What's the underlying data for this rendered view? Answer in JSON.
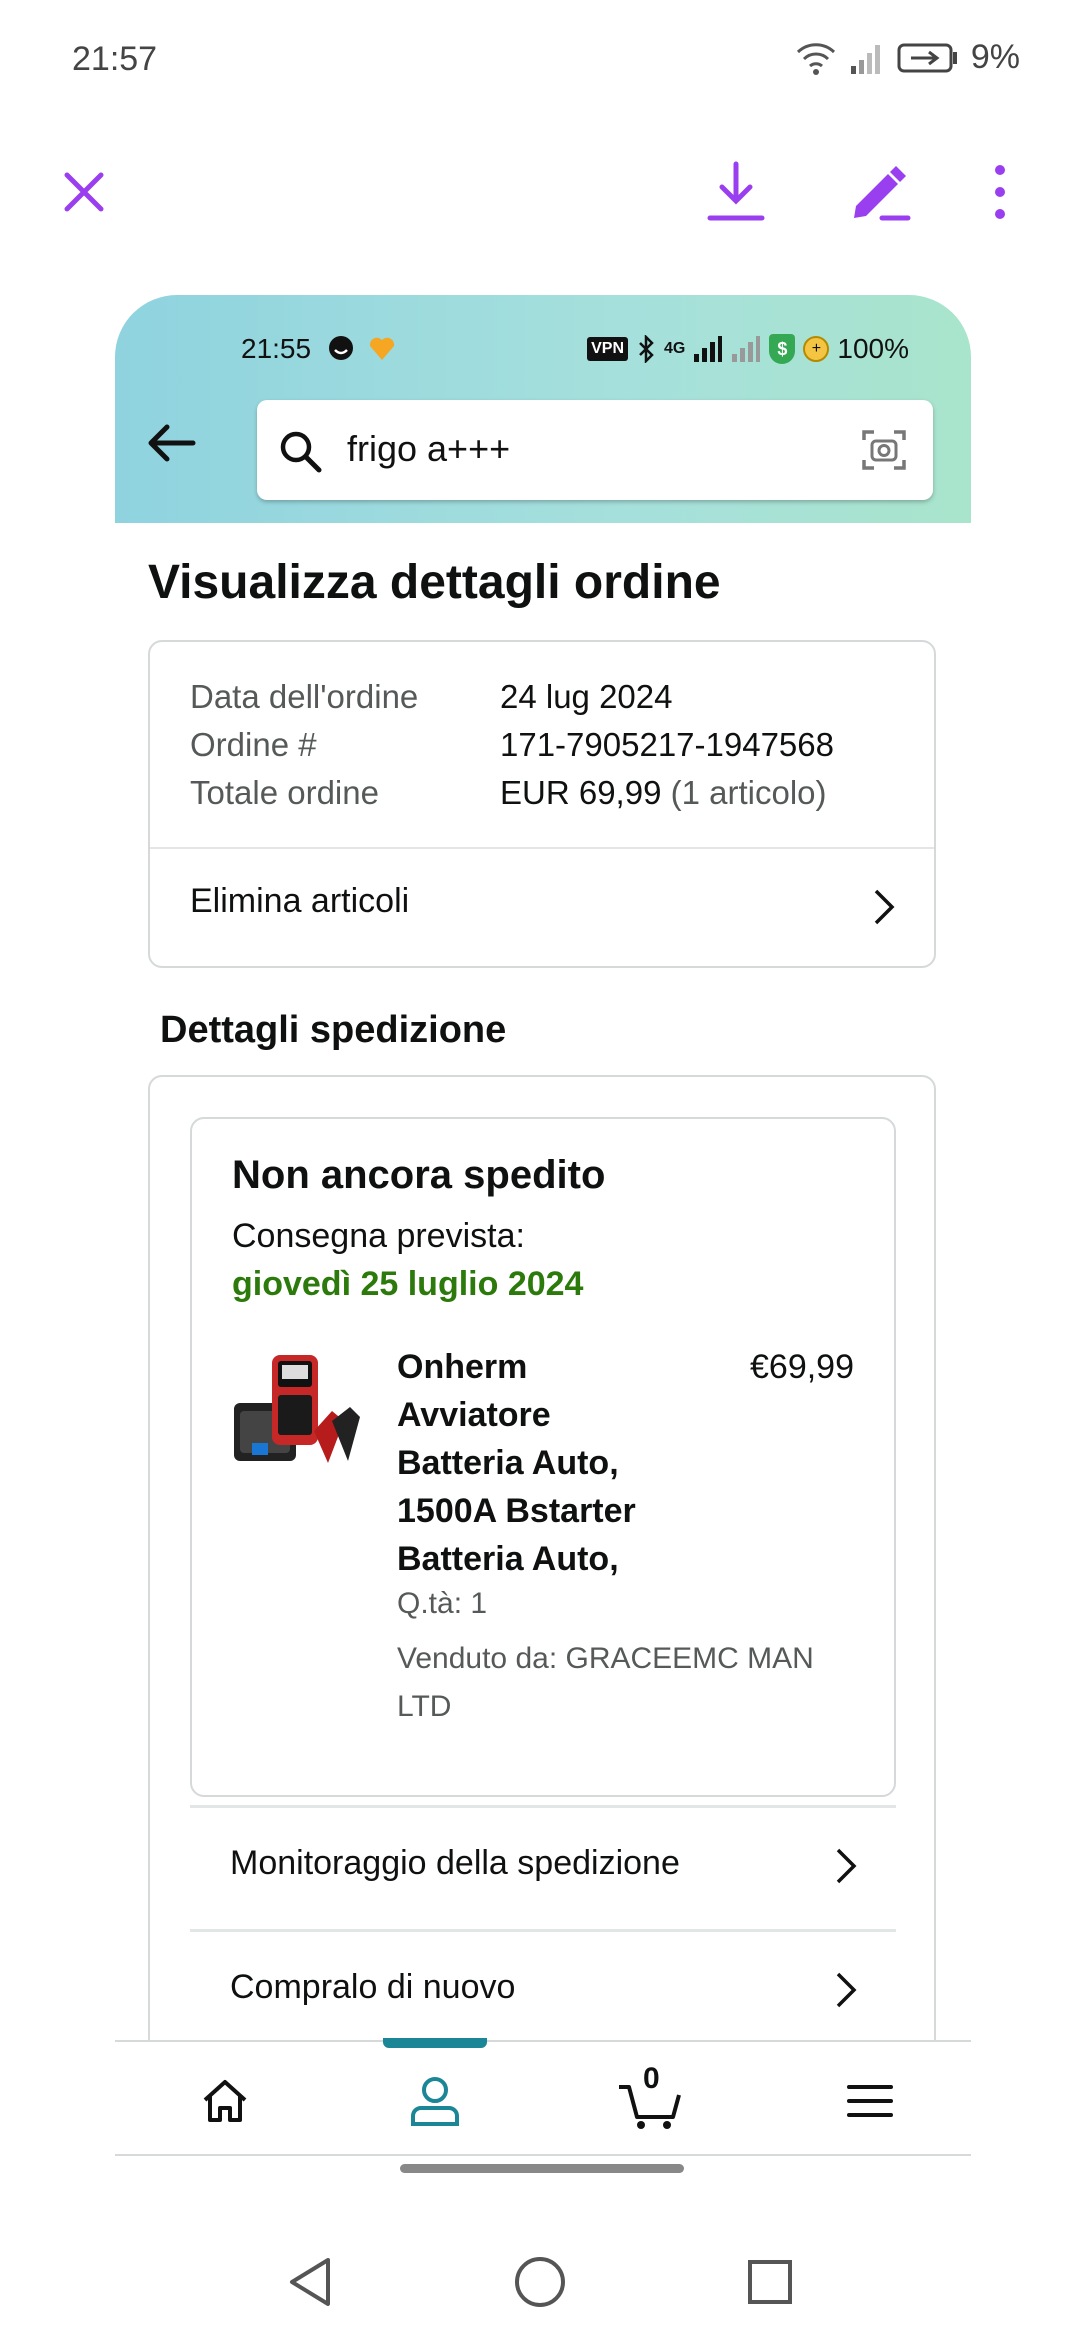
{
  "os_status": {
    "time": "21:57",
    "battery": "9%"
  },
  "viewer": {
    "icons": [
      "close-icon",
      "download-icon",
      "edit-icon",
      "more-icon"
    ],
    "accent": "#9a3ff0"
  },
  "inner_status": {
    "time": "21:55",
    "vpn": "VPN",
    "network": "4G",
    "shield": "$",
    "coin": "+",
    "battery": "100%"
  },
  "search": {
    "query": "frigo a+++"
  },
  "page": {
    "title": "Visualizza dettagli ordine"
  },
  "order": {
    "date_label": "Data dell'ordine",
    "date_value": "24 lug 2024",
    "number_label": "Ordine #",
    "number_value": "171-7905217-1947568",
    "total_label": "Totale ordine",
    "total_value": "EUR 69,99",
    "total_items": "(1 articolo)",
    "delete_label": "Elimina articoli"
  },
  "shipping": {
    "section_title": "Dettagli spedizione",
    "status": "Non ancora spedito",
    "delivery_label": "Consegna prevista:",
    "delivery_date": "giovedì 25 luglio 2024",
    "delivery_color": "#2b7a0b",
    "product": {
      "name": "Onherm Avviatore Batteria Auto, 1500A Bstarter Batteria Auto,",
      "price": "€69,99",
      "qty": "Q.tà: 1",
      "seller": "Venduto da: GRACEEMC MAN LTD"
    },
    "links": [
      "Monitoraggio della spedizione",
      "Compralo di nuovo"
    ]
  },
  "bottom_nav": {
    "cart_count": "0",
    "active_color": "#1b8696"
  }
}
